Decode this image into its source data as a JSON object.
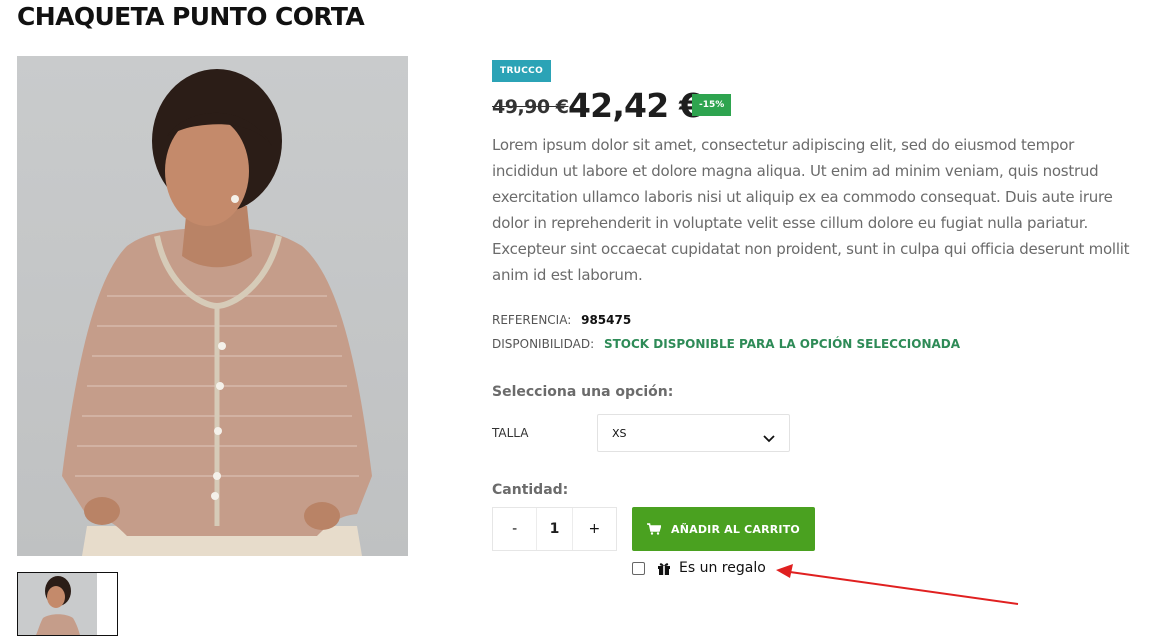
{
  "product": {
    "title": "CHAQUETA PUNTO CORTA",
    "brand_badge": "TRUCCO",
    "price_old": "49,90 €",
    "price_now": "42,42 €",
    "discount_badge": "-15%",
    "description": "Lorem ipsum dolor sit amet, consectetur adipiscing elit, sed do eiusmod tempor incididun ut labore et dolore magna aliqua. Ut enim ad minim veniam, quis nostrud exercitation ullamco laboris nisi ut aliquip ex ea commodo consequat. Duis aute irure dolor in reprehenderit in voluptate velit esse cillum dolore eu fugiat nulla pariatur. Excepteur sint occaecat cupidatat non proident, sunt in culpa qui officia deserunt mollit anim id est laborum."
  },
  "meta": {
    "reference_label": "Referencia:",
    "reference_value": "985475",
    "availability_label": "Disponibilidad:",
    "availability_value": "Stock disponible para la opción seleccionada"
  },
  "options": {
    "title": "Selecciona una opción:",
    "size_label": "TALLA",
    "size_selected": "XS"
  },
  "quantity": {
    "title": "Cantidad:",
    "minus": "-",
    "value": "1",
    "plus": "+"
  },
  "cart": {
    "add_label": "AÑADIR AL CARRITO"
  },
  "gift": {
    "label": "Es un regalo"
  },
  "colors": {
    "brand_badge": "#2ba3b6",
    "discount_badge": "#2ea44f",
    "cart_button": "#4aa120",
    "stock_text": "#2e8b57",
    "annotation_arrow": "#e02020"
  }
}
